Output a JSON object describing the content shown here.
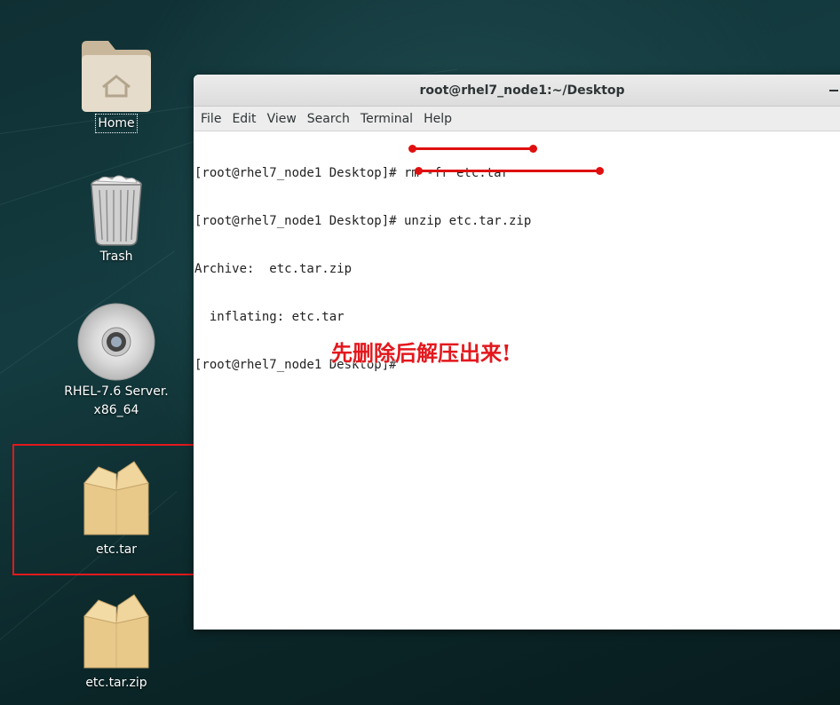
{
  "desktop": {
    "icons": [
      {
        "label": "Home",
        "icon": "home-folder-icon"
      },
      {
        "label": "Trash",
        "icon": "trash-icon"
      },
      {
        "label": "RHEL-7.6 Server.",
        "label2": "x86_64",
        "icon": "disc-icon"
      },
      {
        "label": "etc.tar",
        "icon": "package-icon"
      },
      {
        "label": "etc.tar.zip",
        "icon": "package-icon"
      }
    ]
  },
  "window": {
    "title": "root@rhel7_node1:~/Desktop",
    "menu": [
      "File",
      "Edit",
      "View",
      "Search",
      "Terminal",
      "Help"
    ]
  },
  "terminal": {
    "lines": [
      "[root@rhel7_node1 Desktop]# rm -fr etc.tar",
      "[root@rhel7_node1 Desktop]# unzip etc.tar.zip",
      "Archive:  etc.tar.zip",
      "  inflating: etc.tar",
      "[root@rhel7_node1 Desktop]#"
    ]
  },
  "annotation": {
    "text": "先删除后解压出来!",
    "color": "#e3181d"
  }
}
